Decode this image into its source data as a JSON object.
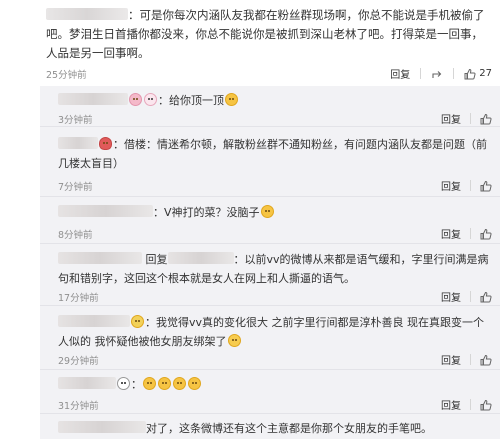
{
  "top_comment": {
    "separator": "：",
    "text": "可是你每次内涵队友我都在粉丝群现场啊，你总不能说是手机被偷了吧。梦泪生日首播你都没来，你总不能说你是被抓到深山老林了吧。打得菜是一回事，人品是另一回事啊。",
    "time": "25分钟前",
    "reply_label": "回复",
    "like_count": "27"
  },
  "replies": [
    {
      "body": "：给你顶一顶",
      "time": "3分钟前",
      "reply_label": "回复"
    },
    {
      "body": "：借楼：情迷希尔顿，解散粉丝群不通知粉丝，有问题内涵队友都是问题（前几楼太盲目）",
      "time": "7分钟前",
      "reply_label": "回复"
    },
    {
      "body": "：V神打的菜？没脑子",
      "time": "8分钟前",
      "reply_label": "回复"
    },
    {
      "prefix": "回复",
      "body": "：以前vv的微博从来都是语气缓和，字里行间满是病句和错别字，这回这个根本就是女人在网上和人撕逼的语气。",
      "time": "17分钟前",
      "reply_label": "回复"
    },
    {
      "body": "：我觉得vv真的变化很大 之前字里行间都是淳朴善良 现在真跟变一个人似的 我怀疑他被他女朋友绑架了",
      "time": "29分钟前",
      "reply_label": "回复"
    },
    {
      "body": "：",
      "time": "31分钟前",
      "reply_label": "回复"
    },
    {
      "body": "对了，这条微博还有这个主意都是你那个女朋友的手笔吧。",
      "time": "",
      "reply_label": ""
    }
  ],
  "icons": {
    "share": "share-icon",
    "like": "thumbs-up-icon"
  },
  "colors": {
    "username": "#eb7350",
    "reply_bg": "#f2f2f5",
    "time": "#8f8f8f"
  }
}
